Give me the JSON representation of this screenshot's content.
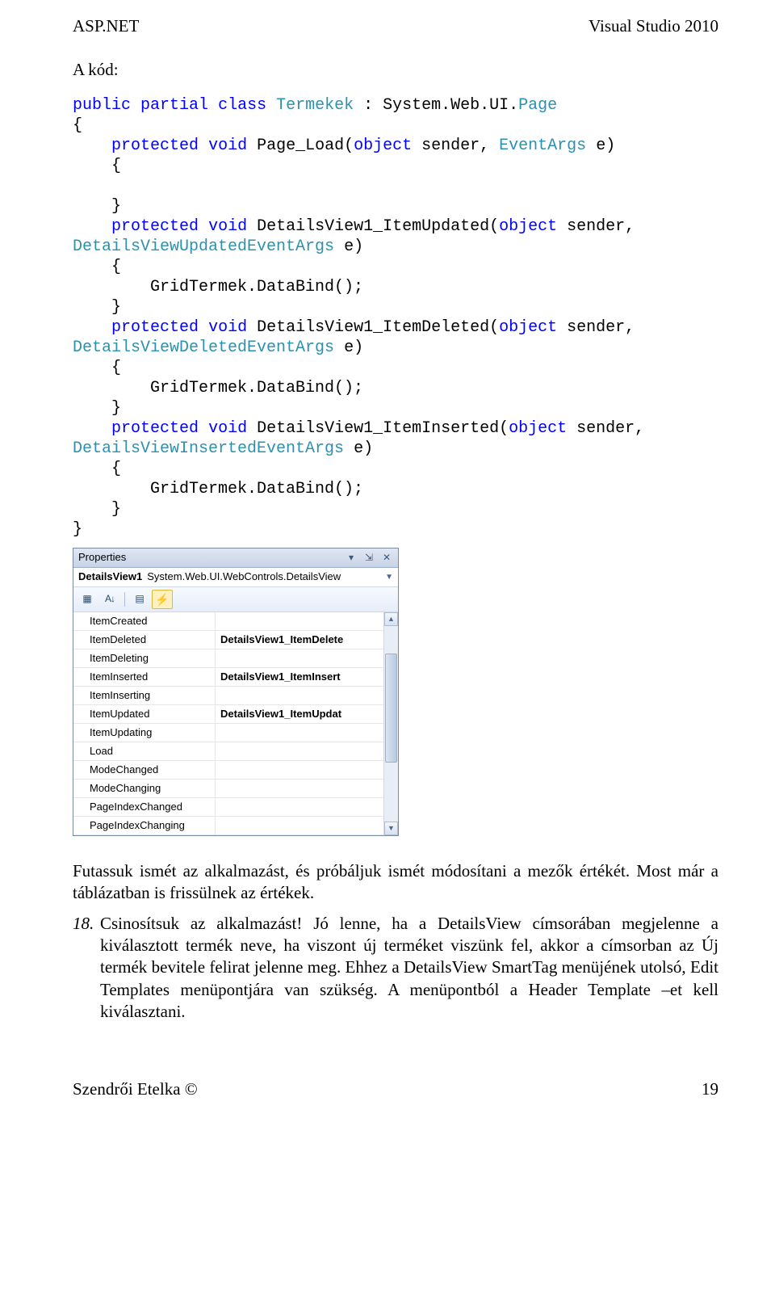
{
  "header": {
    "left": "ASP.NET",
    "right": "Visual Studio 2010"
  },
  "intro": "A kód:",
  "code_tokens": [
    [
      [
        "kw",
        "public"
      ],
      [
        "",
        ""
      ],
      [
        "kw",
        "partial"
      ],
      [
        "",
        ""
      ],
      [
        "kw",
        "class"
      ],
      [
        "",
        ""
      ],
      [
        "type",
        "Termekek"
      ],
      [
        "",
        " : System.Web.UI."
      ],
      [
        "type",
        "Page"
      ]
    ],
    [
      [
        "",
        "{"
      ]
    ],
    [
      [
        "",
        "    "
      ],
      [
        "kw",
        "protected"
      ],
      [
        "",
        ""
      ],
      [
        "kw",
        "void"
      ],
      [
        "",
        " Page_Load("
      ],
      [
        "kw",
        "object"
      ],
      [
        "",
        " sender, "
      ],
      [
        "type",
        "EventArgs"
      ],
      [
        "",
        " e)"
      ]
    ],
    [
      [
        "",
        "    {"
      ]
    ],
    [
      [
        "",
        ""
      ]
    ],
    [
      [
        "",
        "    }"
      ]
    ],
    [
      [
        "",
        "    "
      ],
      [
        "kw",
        "protected"
      ],
      [
        "",
        ""
      ],
      [
        "kw",
        "void"
      ],
      [
        "",
        " DetailsView1_ItemUpdated("
      ],
      [
        "kw",
        "object"
      ],
      [
        "",
        " sender,"
      ]
    ],
    [
      [
        "type",
        "DetailsViewUpdatedEventArgs"
      ],
      [
        "",
        " e)"
      ]
    ],
    [
      [
        "",
        "    {"
      ]
    ],
    [
      [
        "",
        "        GridTermek.DataBind();"
      ]
    ],
    [
      [
        "",
        "    }"
      ]
    ],
    [
      [
        "",
        "    "
      ],
      [
        "kw",
        "protected"
      ],
      [
        "",
        ""
      ],
      [
        "kw",
        "void"
      ],
      [
        "",
        " DetailsView1_ItemDeleted("
      ],
      [
        "kw",
        "object"
      ],
      [
        "",
        " sender,"
      ]
    ],
    [
      [
        "type",
        "DetailsViewDeletedEventArgs"
      ],
      [
        "",
        " e)"
      ]
    ],
    [
      [
        "",
        "    {"
      ]
    ],
    [
      [
        "",
        "        GridTermek.DataBind();"
      ]
    ],
    [
      [
        "",
        "    }"
      ]
    ],
    [
      [
        "",
        "    "
      ],
      [
        "kw",
        "protected"
      ],
      [
        "",
        ""
      ],
      [
        "kw",
        "void"
      ],
      [
        "",
        " DetailsView1_ItemInserted("
      ],
      [
        "kw",
        "object"
      ],
      [
        "",
        " sender,"
      ]
    ],
    [
      [
        "type",
        "DetailsViewInsertedEventArgs"
      ],
      [
        "",
        " e)"
      ]
    ],
    [
      [
        "",
        "    {"
      ]
    ],
    [
      [
        "",
        "        GridTermek.DataBind();"
      ]
    ],
    [
      [
        "",
        "    }"
      ]
    ],
    [
      [
        "",
        "}"
      ]
    ]
  ],
  "prop": {
    "title": "Properties",
    "selector_name": "DetailsView1",
    "selector_type": "System.Web.UI.WebControls.DetailsView",
    "rows": [
      {
        "name": "ItemCreated",
        "value": ""
      },
      {
        "name": "ItemDeleted",
        "value": "DetailsView1_ItemDelete"
      },
      {
        "name": "ItemDeleting",
        "value": ""
      },
      {
        "name": "ItemInserted",
        "value": "DetailsView1_ItemInsert"
      },
      {
        "name": "ItemInserting",
        "value": ""
      },
      {
        "name": "ItemUpdated",
        "value": "DetailsView1_ItemUpdat"
      },
      {
        "name": "ItemUpdating",
        "value": ""
      },
      {
        "name": "Load",
        "value": ""
      },
      {
        "name": "ModeChanged",
        "value": ""
      },
      {
        "name": "ModeChanging",
        "value": ""
      },
      {
        "name": "PageIndexChanged",
        "value": ""
      },
      {
        "name": "PageIndexChanging",
        "value": ""
      }
    ]
  },
  "para1": "Futassuk ismét az alkalmazást, és próbáljuk ismét módosítani a mezők értékét. Most már a táblázatban is frissülnek az értékek.",
  "list_num": "18.",
  "list_text": "Csinosítsuk az alkalmazást! Jó lenne, ha a DetailsView címsorában megjelenne a kiválasztott termék neve, ha viszont új terméket viszünk fel, akkor a címsorban az Új termék bevitele felirat jelenne meg. Ehhez a DetailsView SmartTag menüjének utolsó, Edit Templates menüpontjára van szükség. A menüpontból a Header Template –et kell kiválasztani.",
  "footer": {
    "left": "Szendrői Etelka ©",
    "right": "19"
  }
}
